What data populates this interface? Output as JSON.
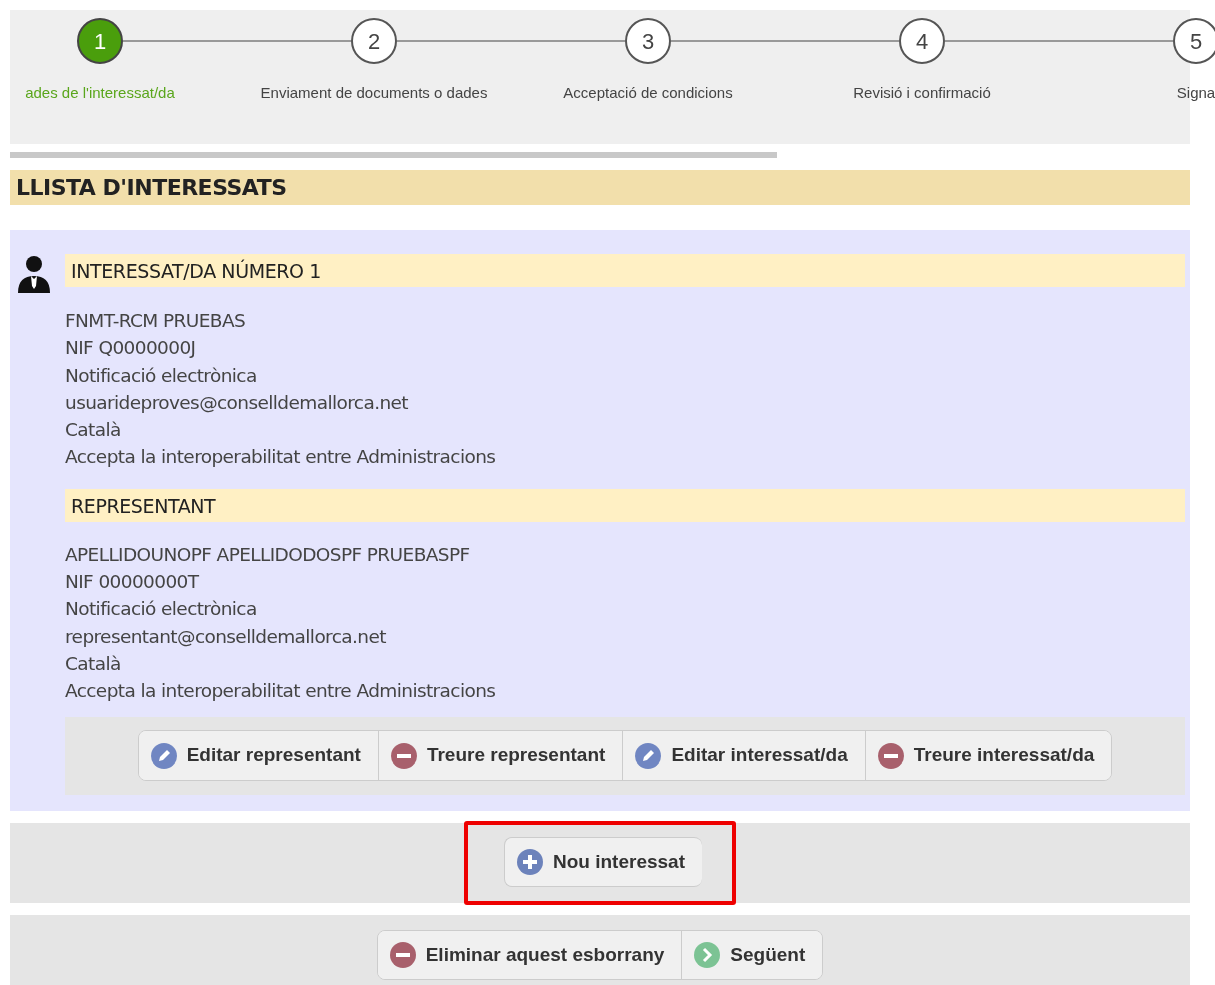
{
  "stepper": {
    "steps": [
      {
        "number": "1",
        "label": "ades de l'interessat/da",
        "selected": true
      },
      {
        "number": "2",
        "label": "Enviament de documents o dades",
        "selected": false
      },
      {
        "number": "3",
        "label": "Acceptació de condicions",
        "selected": false
      },
      {
        "number": "4",
        "label": "Revisió i confirmació",
        "selected": false
      },
      {
        "number": "5",
        "label": "Signa",
        "selected": false
      }
    ],
    "progress": {
      "level": 0.65
    }
  },
  "section_title": "LLISTA D'INTERESSATS",
  "interested": {
    "title": "INTERESSAT/DA NÚMERO 1",
    "details": [
      "FNMT-RCM PRUEBAS",
      "NIF Q0000000J",
      "Notificació electrònica",
      "usuarideproves@conselldemallorca.net",
      "Català",
      "Accepta la interoperabilitat entre Administracions"
    ],
    "representative": {
      "title": "REPRESENTANT",
      "details": [
        "APELLIDOUNOPF APELLIDODOSPF PRUEBASPF",
        "NIF 00000000T",
        "Notificació electrònica",
        "representant@conselldemallorca.net",
        "Català",
        "Accepta la interoperabilitat entre Administracions"
      ]
    },
    "actions": [
      {
        "label": "Editar representant",
        "kind": "edit"
      },
      {
        "label": "Treure representant",
        "kind": "remove"
      },
      {
        "label": "Editar interessat/da",
        "kind": "edit"
      },
      {
        "label": "Treure interessat/da",
        "kind": "remove"
      }
    ]
  },
  "add_button": {
    "label": "Nou interessat",
    "kind": "add",
    "highlighted": true
  },
  "footer_actions": [
    {
      "label": "Eliminar aquest esborrany",
      "kind": "remove"
    },
    {
      "label": "Següent",
      "kind": "next"
    }
  ]
}
